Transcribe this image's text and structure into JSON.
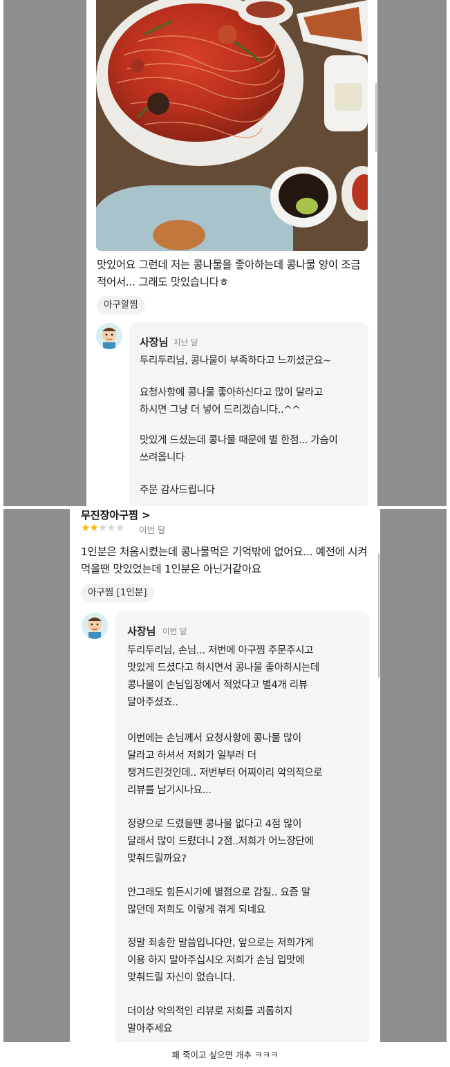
{
  "top_review": {
    "text": "맛있어요 그런데 저는 콩나물을 좋아하는데 콩나물 양이 조금 적어서... 그래도 맛있습니다ㅎ",
    "menu_chip": "아구알찜",
    "owner_name": "사장님",
    "owner_time": "지난 달",
    "reply": [
      "두리두리님, 콩나물이 부족하다고 느끼셨군요~",
      "요청사항에 콩나물 좋아하신다고 많이 달라고\n하시면 그냥 더 넣어 드리겠습니다..^^",
      "맛있게 드셨는데 콩나물 때문에 별 한점... 가슴이\n쓰려옵니다",
      "주문 감사드립니다"
    ]
  },
  "bottom_review": {
    "product_title": "무진장아구찜 >",
    "rating": {
      "stars": 2,
      "max": 5
    },
    "time": "이번 달",
    "text": "1인분은 처음시켰는데 콩나물먹은 기억밖에 없어요... 예전에 시켜먹을땐 맛있었는데 1인분은 아닌거같아요",
    "menu_chip": "아구찜 [1인분]",
    "owner_name": "사장님",
    "owner_time": "이번 달",
    "reply": [
      "두리두리님, 손님... 저번에 아구찜 주문주시고\n맛있게 드셨다고 하시면서 콩나물 좋아하시는데\n콩나물이 손님입장에서 적었다고 별4개 리뷰\n달아주셨죠..",
      "이번에는 손님께서 요청사항에 콩나물 많이\n달라고 하셔서 저희가 일부러 더\n챙겨드린것인데.. 저번부터 어찌이리 악의적으로\n리뷰를 남기시나요...",
      "정량으로 드렸을땐 콩나물 없다고 4점 많이\n달래서 많이 드렸더니 2점..저희가 어느장단에\n맞춰드릴까요?",
      "안그래도 힘든시기에 별점으로 갑질.. 요즘 말\n많던데 저희도 이렇게 겪게 되네요",
      "정말 죄송한 말씀입니다만, 앞으로는 저희가게\n이용 하지 말아주십시오 저희가 손님 입맛에\n맞춰드릴 자신이 없습니다.",
      "더이상 악의적인 리뷰로 저희를 괴롭히지\n말아주세요"
    ]
  },
  "caption": "패 죽이고 싶으면 개추 ㅋㅋㅋ",
  "colors": {
    "gray_border": "#8e8e8e",
    "star": "#f5b800",
    "bubble": "#f5f5f5",
    "chip": "#f2f2f2"
  }
}
